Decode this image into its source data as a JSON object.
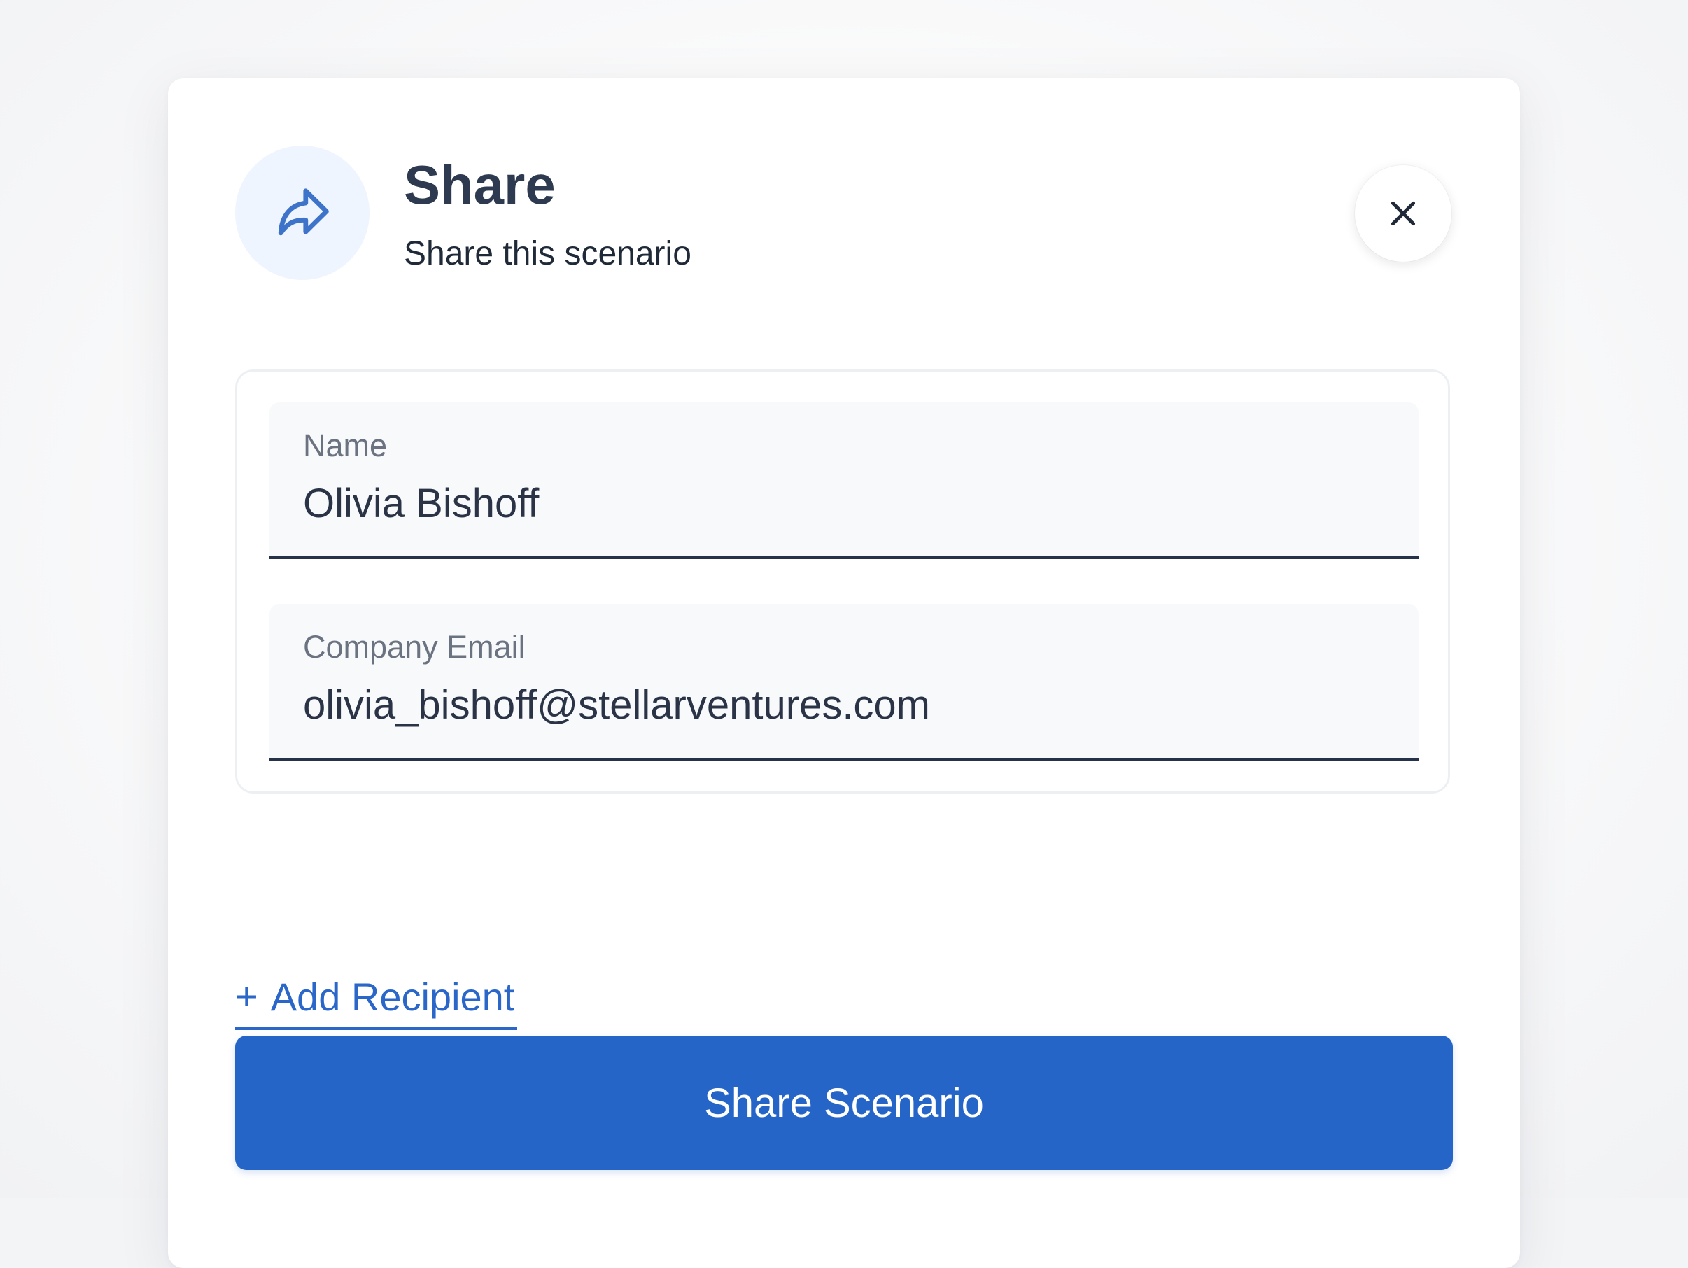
{
  "dialog": {
    "title": "Share",
    "subtitle": "Share this scenario",
    "header_icon": "share-arrow-icon",
    "close_icon": "close-icon"
  },
  "form": {
    "fields": [
      {
        "label": "Name",
        "value": "Olivia Bishoff"
      },
      {
        "label": "Company Email",
        "value": "olivia_bishoff@stellarventures.com"
      }
    ]
  },
  "actions": {
    "add_recipient_prefix": "+",
    "add_recipient_label": "Add Recipient",
    "share_button_label": "Share Scenario"
  },
  "colors": {
    "accent": "#2665c8",
    "link": "#2a67c9",
    "title": "#2d3a4f",
    "icon_bg": "#eff5fe"
  }
}
